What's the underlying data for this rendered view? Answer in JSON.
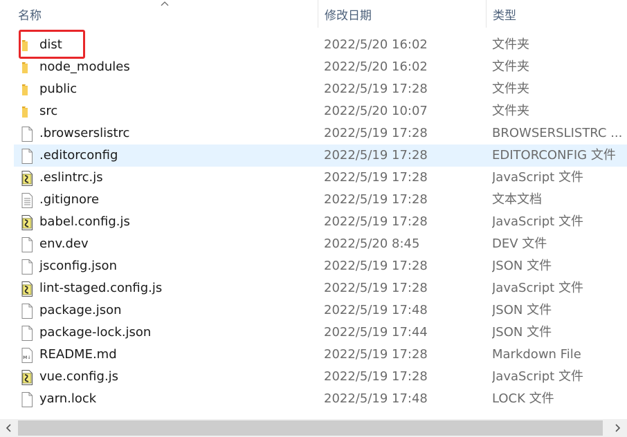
{
  "columns": {
    "name": "名称",
    "date": "修改日期",
    "type": "类型"
  },
  "files": [
    {
      "name": "dist",
      "date": "2022/5/20 16:02",
      "type": "文件夹",
      "icon": "folder-icon"
    },
    {
      "name": "node_modules",
      "date": "2022/5/20 16:02",
      "type": "文件夹",
      "icon": "folder-icon"
    },
    {
      "name": "public",
      "date": "2022/5/19 17:28",
      "type": "文件夹",
      "icon": "folder-icon"
    },
    {
      "name": "src",
      "date": "2022/5/20 10:07",
      "type": "文件夹",
      "icon": "folder-icon"
    },
    {
      "name": ".browserslistrc",
      "date": "2022/5/19 17:28",
      "type": "BROWSERSLISTRC ...",
      "icon": "blank-file-icon"
    },
    {
      "name": ".editorconfig",
      "date": "2022/5/19 17:28",
      "type": "EDITORCONFIG 文件",
      "icon": "blank-file-icon",
      "selected": true
    },
    {
      "name": ".eslintrc.js",
      "date": "2022/5/19 17:28",
      "type": "JavaScript 文件",
      "icon": "js-file-icon"
    },
    {
      "name": ".gitignore",
      "date": "2022/5/19 17:28",
      "type": "文本文档",
      "icon": "text-file-icon"
    },
    {
      "name": "babel.config.js",
      "date": "2022/5/19 17:28",
      "type": "JavaScript 文件",
      "icon": "js-file-icon"
    },
    {
      "name": "env.dev",
      "date": "2022/5/20 8:45",
      "type": "DEV 文件",
      "icon": "blank-file-icon"
    },
    {
      "name": "jsconfig.json",
      "date": "2022/5/19 17:28",
      "type": "JSON 文件",
      "icon": "blank-file-icon"
    },
    {
      "name": "lint-staged.config.js",
      "date": "2022/5/19 17:28",
      "type": "JavaScript 文件",
      "icon": "js-file-icon"
    },
    {
      "name": "package.json",
      "date": "2022/5/19 17:48",
      "type": "JSON 文件",
      "icon": "blank-file-icon"
    },
    {
      "name": "package-lock.json",
      "date": "2022/5/19 17:44",
      "type": "JSON 文件",
      "icon": "blank-file-icon"
    },
    {
      "name": "README.md",
      "date": "2022/5/19 17:28",
      "type": "Markdown File",
      "icon": "markdown-file-icon"
    },
    {
      "name": "vue.config.js",
      "date": "2022/5/19 17:28",
      "type": "JavaScript 文件",
      "icon": "js-file-icon"
    },
    {
      "name": "yarn.lock",
      "date": "2022/5/19 17:48",
      "type": "LOCK 文件",
      "icon": "blank-file-icon"
    }
  ],
  "colors": {
    "folder": "#f4c542",
    "selection": "#e5f3ff",
    "annotation": "#e8272a",
    "header_text": "#4c607a"
  }
}
